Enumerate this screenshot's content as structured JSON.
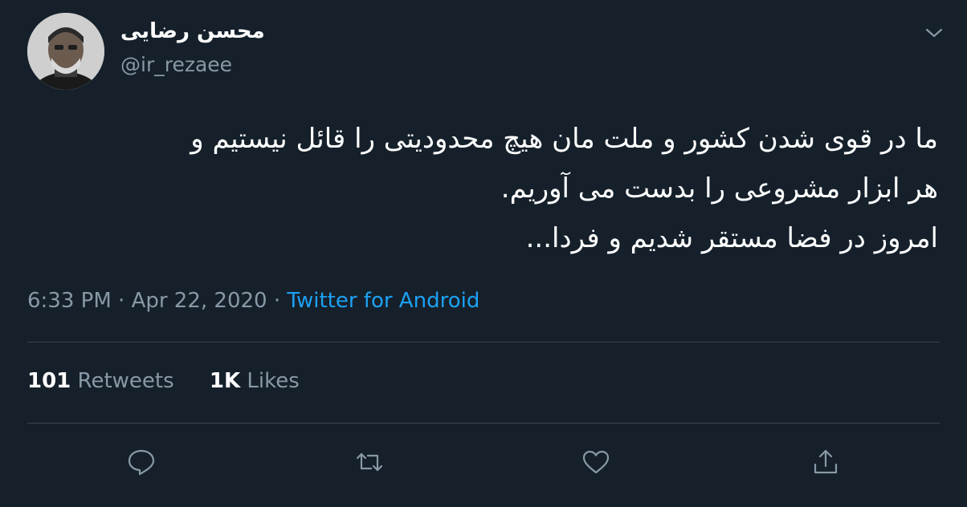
{
  "author": {
    "display_name": "محسن رضایی",
    "handle": "@ir_rezaee"
  },
  "tweet": {
    "lines": [
      "ما در قوی شدن کشور و ملت مان هیچ محدودیتی را قائل نیستیم و",
      "هر ابزار مشروعی را بدست می آوریم.",
      "امروز در فضا مستقر شدیم و فردا..."
    ]
  },
  "meta": {
    "time": "6:33 PM",
    "separator": "·",
    "date": "Apr 22, 2020",
    "source": "Twitter for Android"
  },
  "stats": {
    "retweets_count": "101",
    "retweets_label": "Retweets",
    "likes_count": "1K",
    "likes_label": "Likes"
  },
  "icons": {
    "caret": "chevron-down-icon",
    "reply": "reply-icon",
    "retweet": "retweet-icon",
    "like": "heart-icon",
    "share": "share-icon"
  },
  "colors": {
    "background": "#15202b",
    "secondary_text": "#8899a6",
    "link": "#1da1f2",
    "divider": "#38444d"
  }
}
